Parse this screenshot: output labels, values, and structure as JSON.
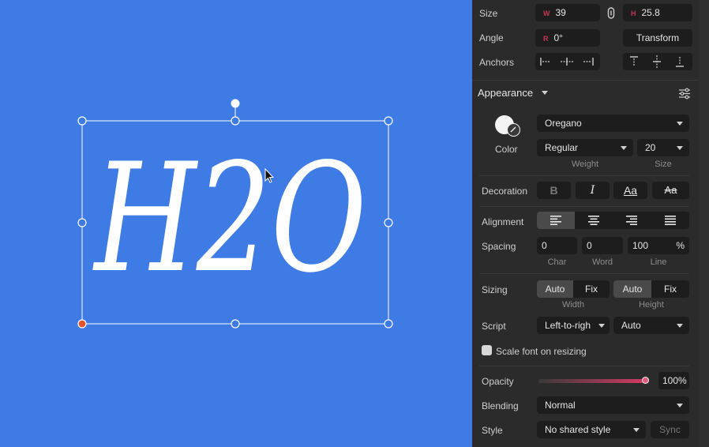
{
  "canvas": {
    "background": "#3f7be4",
    "text": "H2O",
    "selection_color": "#ffffff",
    "anchor_color": "#e0542f"
  },
  "geometry": {
    "size_label": "Size",
    "width_prefix": "W",
    "width": "39",
    "height_prefix": "H",
    "height": "25.8",
    "angle_label": "Angle",
    "angle_prefix": "R",
    "angle": "0°",
    "transform_button": "Transform",
    "anchors_label": "Anchors"
  },
  "appearance": {
    "header": "Appearance",
    "color_label": "Color",
    "font": "Oregano",
    "weight": "Regular",
    "weight_label": "Weight",
    "size": "20",
    "size_label": "Size",
    "decoration_label": "Decoration",
    "decoration_bold": "B",
    "decoration_italic": "I",
    "decoration_case": "Aa",
    "decoration_strike": "Aa",
    "alignment_label": "Alignment",
    "spacing_label": "Spacing",
    "char": "0",
    "char_label": "Char",
    "word": "0",
    "word_label": "Word",
    "line": "100",
    "line_unit": "%",
    "line_label": "Line",
    "sizing_label": "Sizing",
    "sizing_width_auto": "Auto",
    "sizing_width_fix": "Fix",
    "sizing_width_label": "Width",
    "sizing_height_auto": "Auto",
    "sizing_height_fix": "Fix",
    "sizing_height_label": "Height",
    "script_label": "Script",
    "script_direction": "Left-to-righ",
    "script_value": "Auto",
    "scale_font_label": "Scale font on resizing",
    "opacity_label": "Opacity",
    "opacity_fraction": 1.0,
    "opacity_value": "100%",
    "blending_label": "Blending",
    "blending_value": "Normal",
    "style_label": "Style",
    "style_value": "No shared style",
    "sync_button": "Sync"
  }
}
